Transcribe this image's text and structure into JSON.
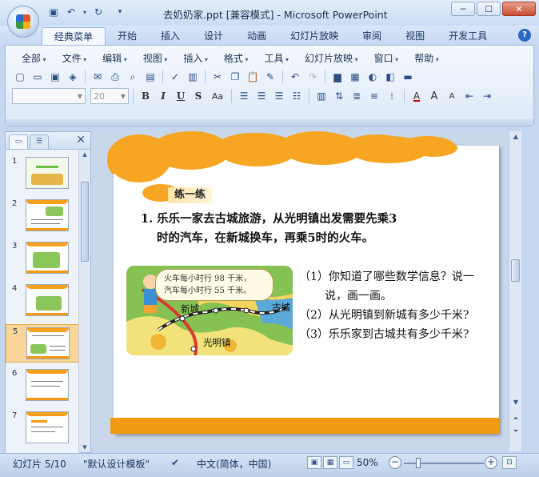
{
  "window": {
    "title": "去奶奶家.ppt [兼容模式] - Microsoft PowerPoint",
    "controls": {
      "minimize": "─",
      "maximize": "☐",
      "close": "✕"
    }
  },
  "quick_access": {
    "save_icon": "save-icon",
    "undo_icon": "undo-icon",
    "redo_icon": "redo-icon",
    "more": "▾"
  },
  "tabs": [
    {
      "label": "经典菜单",
      "active": true
    },
    {
      "label": "开始"
    },
    {
      "label": "插入"
    },
    {
      "label": "设计"
    },
    {
      "label": "动画"
    },
    {
      "label": "幻灯片放映"
    },
    {
      "label": "审阅"
    },
    {
      "label": "视图"
    },
    {
      "label": "开发工具"
    }
  ],
  "classic_menu": [
    "全部",
    "文件",
    "编辑",
    "视图",
    "插入",
    "格式",
    "工具",
    "幻灯片放映",
    "窗口",
    "帮助"
  ],
  "font_controls": {
    "font_name": "",
    "font_size": "20"
  },
  "format_buttons": {
    "bold": "B",
    "italic": "I",
    "underline": "U",
    "strike": "S",
    "case": "Aa"
  },
  "left_panel": {
    "slides": [
      {
        "num": "1"
      },
      {
        "num": "2"
      },
      {
        "num": "3"
      },
      {
        "num": "4"
      },
      {
        "num": "5",
        "selected": true
      },
      {
        "num": "6"
      },
      {
        "num": "7"
      }
    ],
    "close": "✕"
  },
  "slide": {
    "section_label": "练一练",
    "question_line1": "1. 乐乐一家去古城旅游，从光明镇出发需要先乘3",
    "question_line2": "时的汽车，在新城换车，再乘5时的火车。",
    "speech_line1": "火车每小时行 98 千米，",
    "speech_line2": "汽车每小时行 55 千米。",
    "map_labels": {
      "new_city": "新城",
      "old_city": "古城",
      "guangming": "光明镇"
    },
    "sub_q1_line1": "（1）你知道了哪些数学信息？说一",
    "sub_q1_line2": "说，画一画。",
    "sub_q2": "（2）从光明镇到新城有多少千米?",
    "sub_q3": "（3）乐乐家到古城共有多少千米?"
  },
  "status": {
    "slide_info": "幻灯片 5/10",
    "template": "\"默认设计模板\"",
    "language": "中文(简体，中国)",
    "zoom": "50%"
  }
}
